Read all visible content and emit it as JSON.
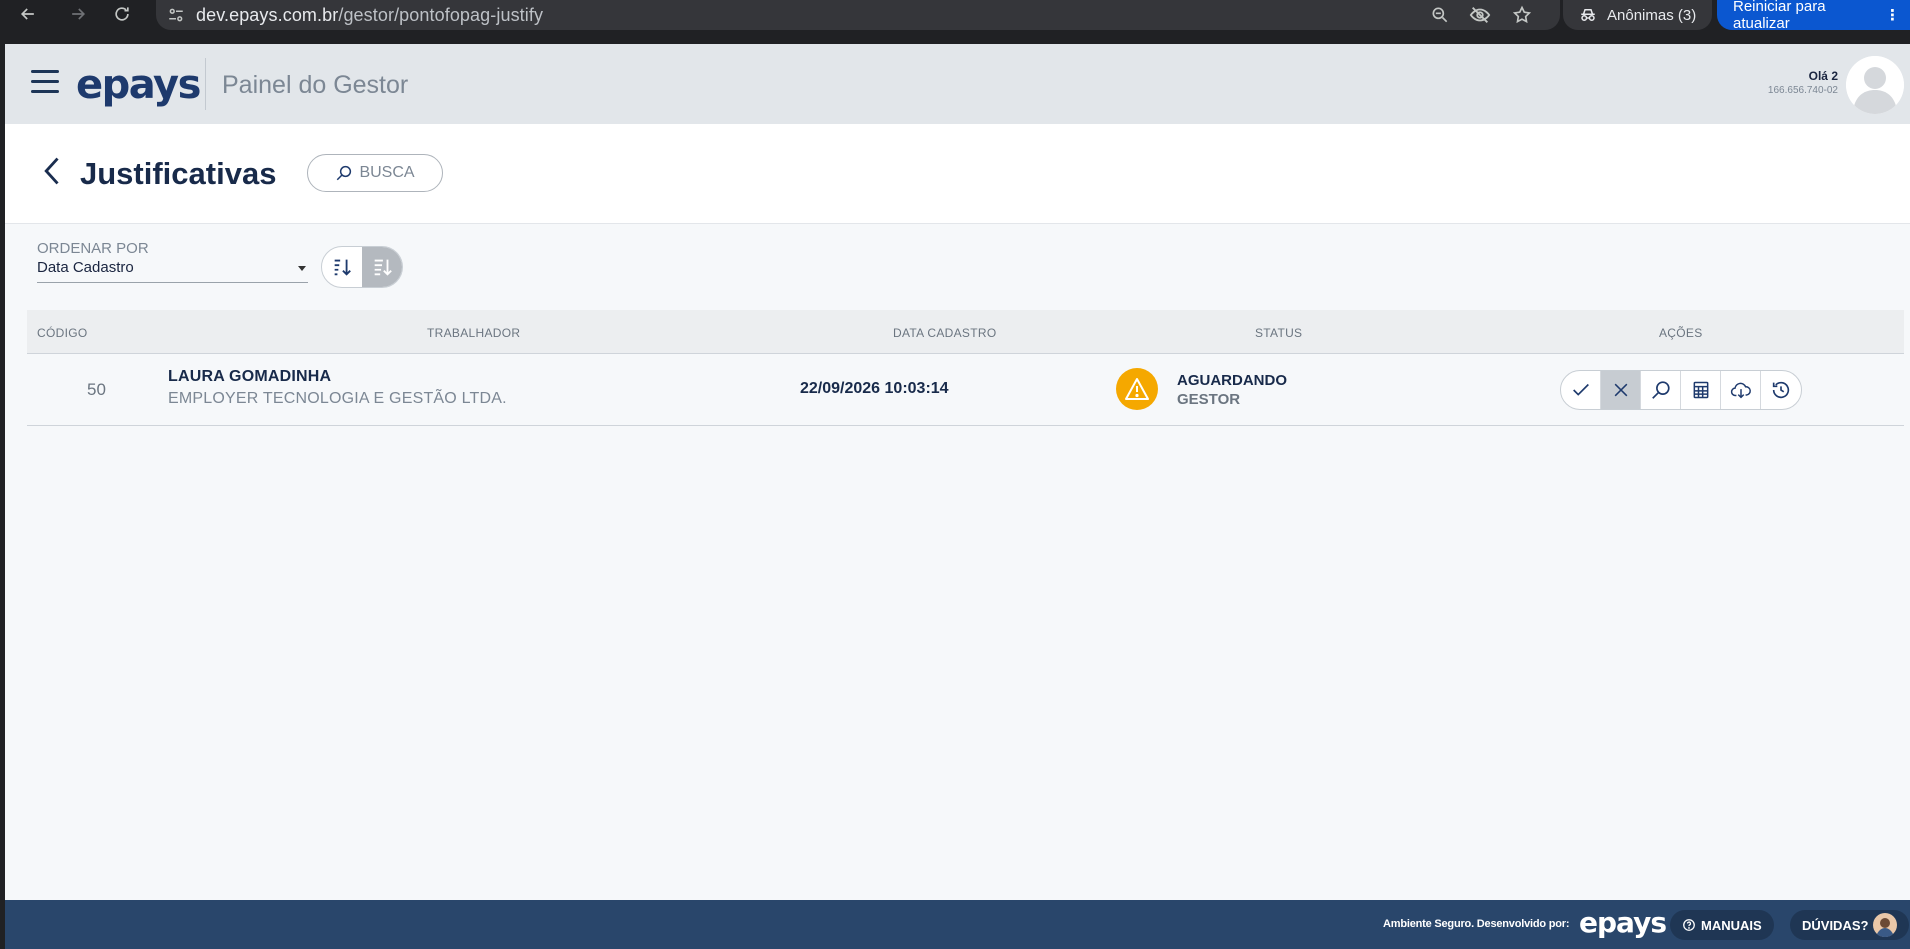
{
  "browser": {
    "url_host": "dev.epays.com.br",
    "url_path": "/gestor/pontofopag-justify",
    "profile_label": "Anônimas (3)",
    "update_label": "Reiniciar para atualizar"
  },
  "header": {
    "logo": "epays",
    "panel_title": "Painel do Gestor",
    "greeting": "Olá 2",
    "user_id": "166.656.740-02"
  },
  "page": {
    "title": "Justificativas",
    "search_label": "BUSCA"
  },
  "sort": {
    "label": "ORDENAR POR",
    "selected": "Data Cadastro"
  },
  "table": {
    "headers": {
      "code": "CÓDIGO",
      "worker": "TRABALHADOR",
      "date": "DATA CADASTRO",
      "status": "STATUS",
      "actions": "AÇÕES"
    },
    "rows": [
      {
        "code": "50",
        "worker_name": "LAURA GOMADINHA",
        "company": "EMPLOYER TECNOLOGIA E GESTÃO LTDA.",
        "date": "22/09/2026 10:03:14",
        "status_line1": "AGUARDANDO",
        "status_line2": "GESTOR",
        "status_color": "#f5a800"
      }
    ]
  },
  "footer": {
    "developed_by": "Ambiente Seguro. Desenvolvido por:",
    "logo": "epays",
    "manuals": "MANUAIS",
    "questions": "DÚVIDAS?"
  },
  "icons": [
    "back-icon",
    "forward-icon",
    "reload-icon",
    "site-settings-icon",
    "zoom-icon",
    "eye-off-icon",
    "star-icon",
    "incognito-icon",
    "menu-icon",
    "chevron-left-icon",
    "search-icon",
    "sort-asc-icon",
    "sort-desc-icon",
    "warning-icon",
    "check-icon",
    "close-icon",
    "search-icon",
    "calculator-icon",
    "cloud-download-icon",
    "history-icon",
    "help-circle-icon"
  ],
  "colors": {
    "brand": "#1e3a6d",
    "footer": "#29466b",
    "warning": "#f5a800",
    "update_button": "#0b57d0"
  }
}
